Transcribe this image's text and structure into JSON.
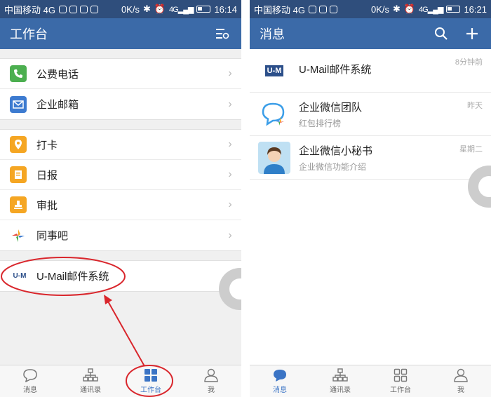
{
  "left": {
    "status": {
      "carrier": "中国移动 4G",
      "speed": "0K/s",
      "network": "4G",
      "time": "16:14"
    },
    "header": {
      "title": "工作台"
    },
    "groups": [
      {
        "items": [
          {
            "label": "公费电话"
          },
          {
            "label": "企业邮箱"
          }
        ]
      },
      {
        "items": [
          {
            "label": "打卡"
          },
          {
            "label": "日报"
          },
          {
            "label": "审批"
          },
          {
            "label": "同事吧"
          }
        ]
      },
      {
        "items": [
          {
            "label": "U-Mail邮件系统"
          }
        ]
      }
    ],
    "tabs": [
      {
        "label": "消息"
      },
      {
        "label": "通讯录"
      },
      {
        "label": "工作台"
      },
      {
        "label": "我"
      }
    ],
    "logo_text": "U-M",
    "active_tab": 2
  },
  "right": {
    "status": {
      "carrier": "中国移动 4G",
      "speed": "0K/s",
      "network": "4G",
      "time": "16:21"
    },
    "header": {
      "title": "消息"
    },
    "messages": [
      {
        "name": "U-Mail邮件系统",
        "subtitle": "",
        "time": "8分钟前",
        "logo_text": "U-M"
      },
      {
        "name": "企业微信团队",
        "subtitle": "红包排行榜",
        "time": "昨天"
      },
      {
        "name": "企业微信小秘书",
        "subtitle": "企业微信功能介绍",
        "time": "星期二"
      }
    ],
    "tabs": [
      {
        "label": "消息"
      },
      {
        "label": "通讯录"
      },
      {
        "label": "工作台"
      },
      {
        "label": "我"
      }
    ],
    "active_tab": 0
  },
  "colors": {
    "statusbar": "#2f4e7c",
    "navbar": "#3b6aa8",
    "active_tab": "#3b74c5",
    "annotation_red": "#d9262c"
  }
}
